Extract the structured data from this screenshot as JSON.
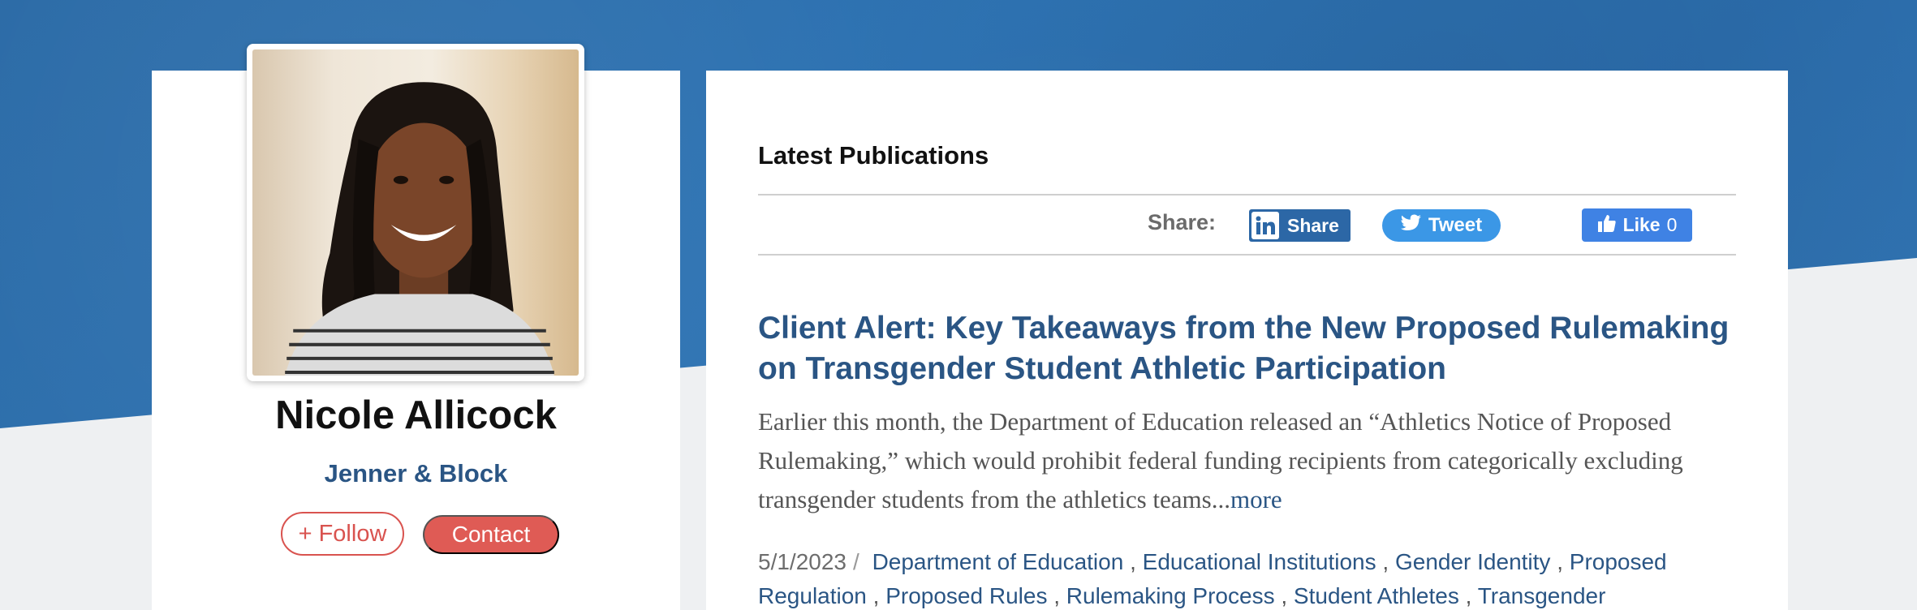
{
  "profile": {
    "name": "Nicole Allicock",
    "organization": "Jenner & Block",
    "follow_label": "+ Follow",
    "contact_label": "Contact"
  },
  "publications": {
    "section_title": "Latest Publications",
    "share": {
      "label": "Share:",
      "linkedin_label": "Share",
      "twitter_label": "Tweet",
      "facebook_label": "Like",
      "facebook_count": "0"
    },
    "article": {
      "title": "Client Alert: Key Takeaways from the New Proposed Rulemaking on Transgender Student Athletic Participation",
      "excerpt": "Earlier this month, the Department of Education released an “Athletics Notice of Proposed Rulemaking,” which would prohibit federal funding recipients from categorically excluding transgender students from the athletics teams...",
      "more_label": "more",
      "date": "5/1/2023",
      "date_separator": "/",
      "tags": [
        "Department of Education",
        "Educational Institutions",
        "Gender Identity",
        "Proposed Regulation",
        "Proposed Rules",
        "Rulemaking Process",
        "Student Athletes",
        "Transgender"
      ]
    }
  },
  "colors": {
    "accent_blue": "#2a5584",
    "follow_red": "#d9534f",
    "linkedin": "#2c67a6",
    "twitter": "#3b97e6",
    "facebook": "#3f82e4"
  }
}
